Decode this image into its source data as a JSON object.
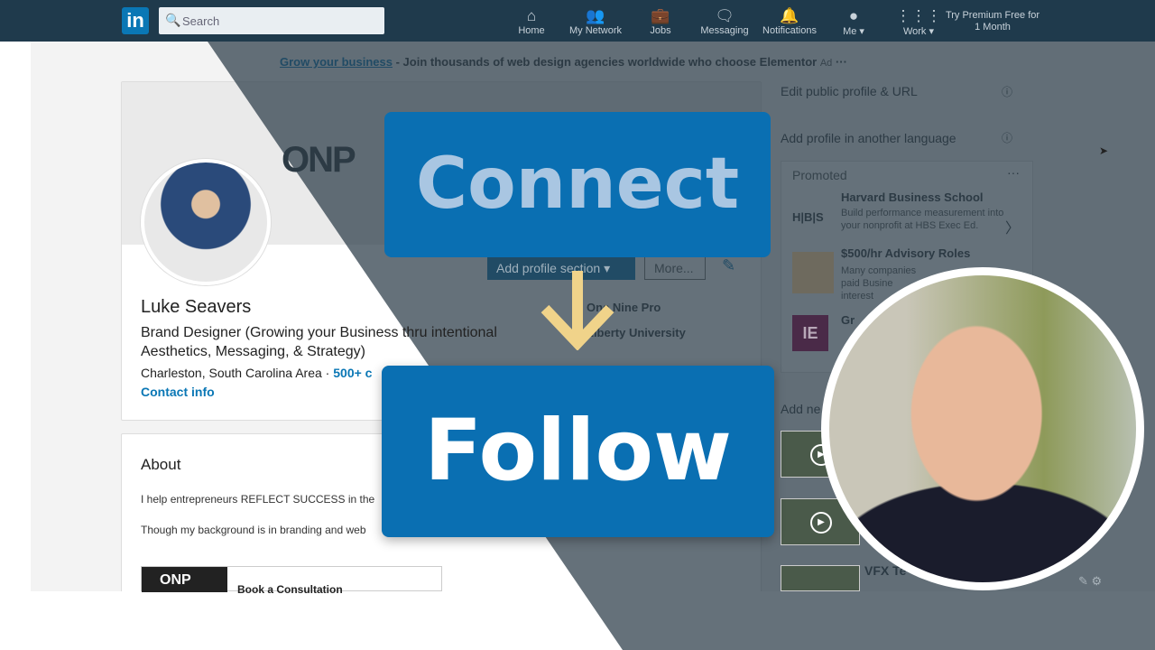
{
  "nav": {
    "logo": "in",
    "search_placeholder": "Search",
    "items": [
      {
        "label": "Home",
        "icon": "home-icon",
        "glyph": "⌂"
      },
      {
        "label": "My Network",
        "icon": "network-icon",
        "glyph": "👥"
      },
      {
        "label": "Jobs",
        "icon": "briefcase-icon",
        "glyph": "💼"
      },
      {
        "label": "Messaging",
        "icon": "messaging-icon",
        "glyph": "🗨"
      },
      {
        "label": "Notifications",
        "icon": "bell-icon",
        "glyph": "🔔"
      },
      {
        "label": "Me ▾",
        "icon": "avatar-icon",
        "glyph": "●"
      },
      {
        "label": "Work ▾",
        "icon": "grid-icon",
        "glyph": "⋮⋮⋮"
      }
    ],
    "premium": "Try Premium Free for 1 Month"
  },
  "ad": {
    "link": "Grow your business",
    "text": " - Join thousands of web design agencies worldwide who choose Elementor",
    "tag": "Ad",
    "more": "···"
  },
  "profile": {
    "banner_logo": "ONP",
    "name": "Luke Seavers",
    "headline": "Brand Designer (Growing your Business thru intentional Aesthetics, Messaging, & Strategy)",
    "location": "Charleston, South Carolina Area",
    "connections": "500+ c",
    "contact": "Contact info",
    "add_section": "Add profile section ▾",
    "more": "More...",
    "company": "One Nine Pro",
    "school": "Liberty University"
  },
  "about": {
    "title": "About",
    "line1": "I help entrepreneurs REFLECT SUCCESS in the",
    "line2": "Though my background is in branding and web",
    "media_thumb": "ONP",
    "media_title": "Book a Consultation"
  },
  "sidebar": {
    "edit_url": "Edit public profile & URL",
    "add_language": "Add profile in another language",
    "promoted": "Promoted",
    "promo_more": "···",
    "promos": [
      {
        "title": "Harvard Business School",
        "desc": "Build performance measurement into your nonprofit at HBS Exec Ed.",
        "logo": "H|B|S"
      },
      {
        "title": "$500/hr Advisory Roles",
        "desc": "Many companies paid Busine interest"
      },
      {
        "title": "Gr",
        "desc": "",
        "logo": "IE"
      }
    ],
    "add_new": "Add ne",
    "vfx": "VFX Te"
  },
  "overlay": {
    "connect": "Connect",
    "follow": "Follow",
    "arrow_color": "#f0d38a",
    "box_color": "#0a6fb2"
  }
}
